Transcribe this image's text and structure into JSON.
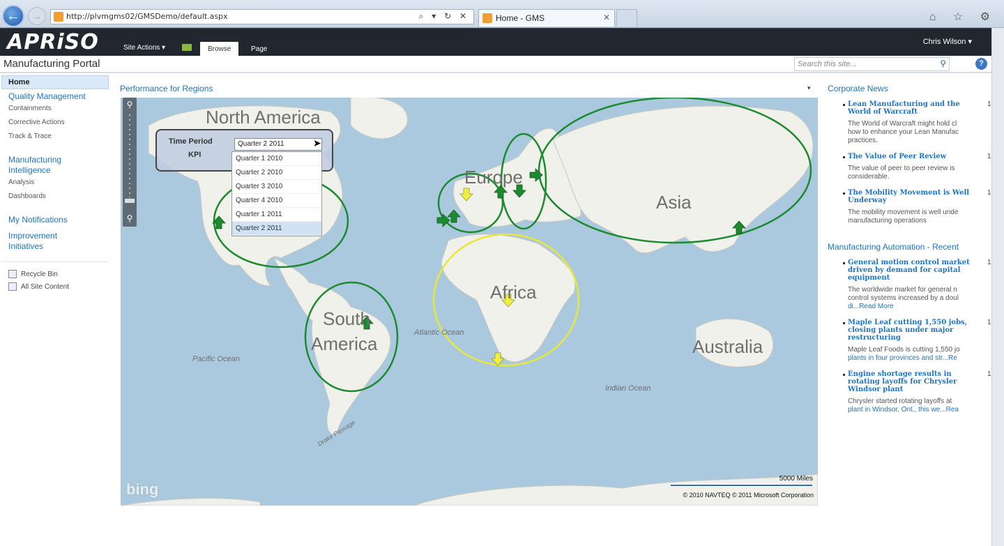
{
  "browser": {
    "url": "http://plvmgms02/GMSDemo/default.aspx",
    "tab_title": "Home - GMS",
    "addr_controls": "⌕ ▾ ↻ ✕",
    "tab_close": "✕",
    "tools_icons": "⌂ ☆ ⚙"
  },
  "ribbon": {
    "logo": "APRiSO",
    "site_actions": "Site Actions ▾",
    "tabs": [
      "Browse",
      "Page"
    ],
    "user": "Chris Wilson ▾"
  },
  "header": {
    "title": "Manufacturing Portal",
    "search_placeholder": "Search this site...",
    "help": "?"
  },
  "nav": {
    "home": "Home",
    "groups": [
      {
        "title": "Quality Management",
        "items": [
          "Containments",
          "Corrective Actions",
          "Track & Trace"
        ]
      },
      {
        "title": "Manufacturing Intelligence",
        "items": [
          "Analysis",
          "Dashboards"
        ]
      },
      {
        "title": "My Notifications",
        "items": []
      },
      {
        "title": "Improvement Initiatives",
        "items": []
      }
    ],
    "utilities": [
      "Recycle Bin",
      "All Site Content"
    ]
  },
  "map_part": {
    "title": "Performance for Regions",
    "menu": "▾",
    "filter": {
      "time_period_label": "Time Period",
      "kpi_label": "KPI",
      "selected": "Quarter 2 2011",
      "options": [
        "Quarter 1 2010",
        "Quarter 2 2010",
        "Quarter 3 2010",
        "Quarter 4 2010",
        "Quarter 1 2011",
        "Quarter 2 2011"
      ]
    },
    "labels": {
      "north_america": "North America",
      "europe": "Europe",
      "asia": "Asia",
      "africa": "Africa",
      "south_america_1": "South",
      "south_america_2": "America",
      "australia": "Australia",
      "pacific": "Pacific Ocean",
      "atlantic": "Atlantic Ocean",
      "indian": "Indian Ocean",
      "drake": "Drake Passage"
    },
    "bing": "bing",
    "scale": "5000 Miles",
    "copyright": "© 2010 NAVTEQ   © 2011 Microsoft Corporation",
    "colors": {
      "good": "#1c8a2e",
      "warn": "#e8e83a",
      "water": "#aac9df"
    }
  },
  "corporate_news": {
    "title": "Corporate News",
    "items": [
      {
        "title": "Lean Manufacturing and the World of Warcraft",
        "num": "1",
        "desc": [
          "The World of Warcraft might hold cl",
          "how to enhance your Lean Manufac",
          "practices."
        ],
        "more": ""
      },
      {
        "title": "The Value of Peer Review",
        "num": "1",
        "desc": [
          "The value of peer to peer review is",
          "considerable."
        ],
        "more": ""
      },
      {
        "title": "The Mobility Movement is Well Underway",
        "num": "1",
        "desc": [
          "The mobility movement is well unde",
          "manufacturing operations"
        ],
        "more": ""
      }
    ]
  },
  "mfg_automation": {
    "title": "Manufacturing Automation - Recent",
    "items": [
      {
        "title": "General motion control market driven by demand for capital equipment",
        "num": "1",
        "desc": [
          "The worldwide market for general n",
          "control systems increased by a doul",
          "di..."
        ],
        "more": "Read More"
      },
      {
        "title": "Maple Leaf cutting 1,550 jobs, closing plants under major restructuring",
        "num": "1",
        "desc": [
          "Maple Leaf Foods is cutting 1,550 jo",
          "plants in four provinces and str..."
        ],
        "more": "Re"
      },
      {
        "title": "Engine shortage results in rotating layoffs for Chrysler Windsor plant",
        "num": "1",
        "desc": [
          "Chrysler started rotating layoffs at",
          "plant in Windsor, Ont., this we..."
        ],
        "more": "Rea"
      }
    ]
  }
}
